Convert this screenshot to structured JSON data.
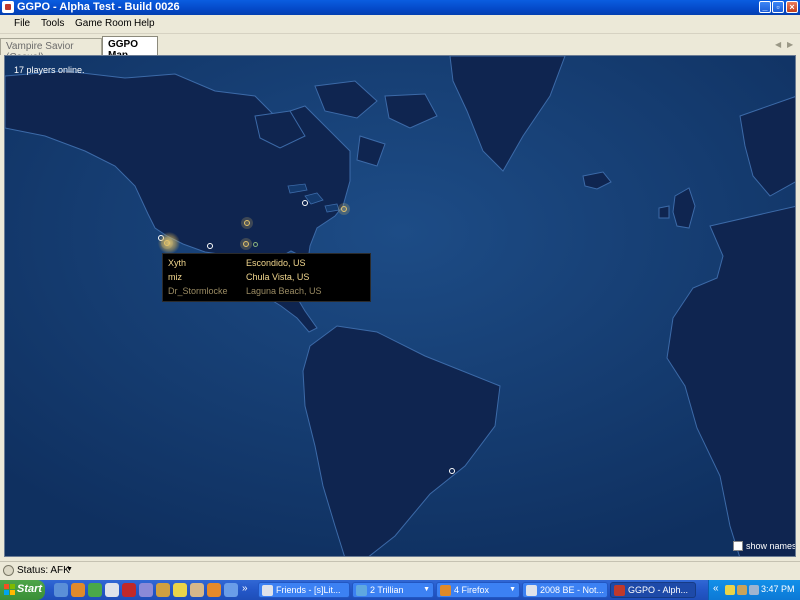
{
  "window": {
    "title": "GGPO - Alpha Test - Build 0026"
  },
  "menu": [
    "File",
    "Tools",
    "Game Room",
    "Help"
  ],
  "tabs": [
    {
      "label": "Vampire Savior (Casual)",
      "active": false
    },
    {
      "label": "GGPO Map",
      "active": true
    }
  ],
  "map": {
    "online_text": "17 players online.",
    "tooltip": {
      "rows": [
        {
          "name": "Xyth",
          "location": "Escondido, US",
          "style": "highlight"
        },
        {
          "name": "miz",
          "location": "Chula Vista, US",
          "style": "highlight"
        },
        {
          "name": "Dr_Stormlocke",
          "location": "Laguna Beach, US",
          "style": "dim"
        }
      ]
    },
    "show_names_label": "show names",
    "show_names_checked": false,
    "colors": {
      "ocean": "#143a6e",
      "land": "#0f2550",
      "coast": "#3c6aa8",
      "highlight": "#f2d78e"
    }
  },
  "status": {
    "text": "Status: AFK"
  },
  "taskbar": {
    "start_label": "Start",
    "chevron": "»",
    "buttons": [
      {
        "label": "Friends - [s]Lit...",
        "active": false
      },
      {
        "label": "2 Trillian",
        "active": false
      },
      {
        "label": "4 Firefox",
        "active": false
      },
      {
        "label": "2008 BE - Not...",
        "active": false
      },
      {
        "label": "GGPO - Alph...",
        "active": true
      }
    ],
    "tray_chevron": "«",
    "clock": "3:47 PM"
  }
}
